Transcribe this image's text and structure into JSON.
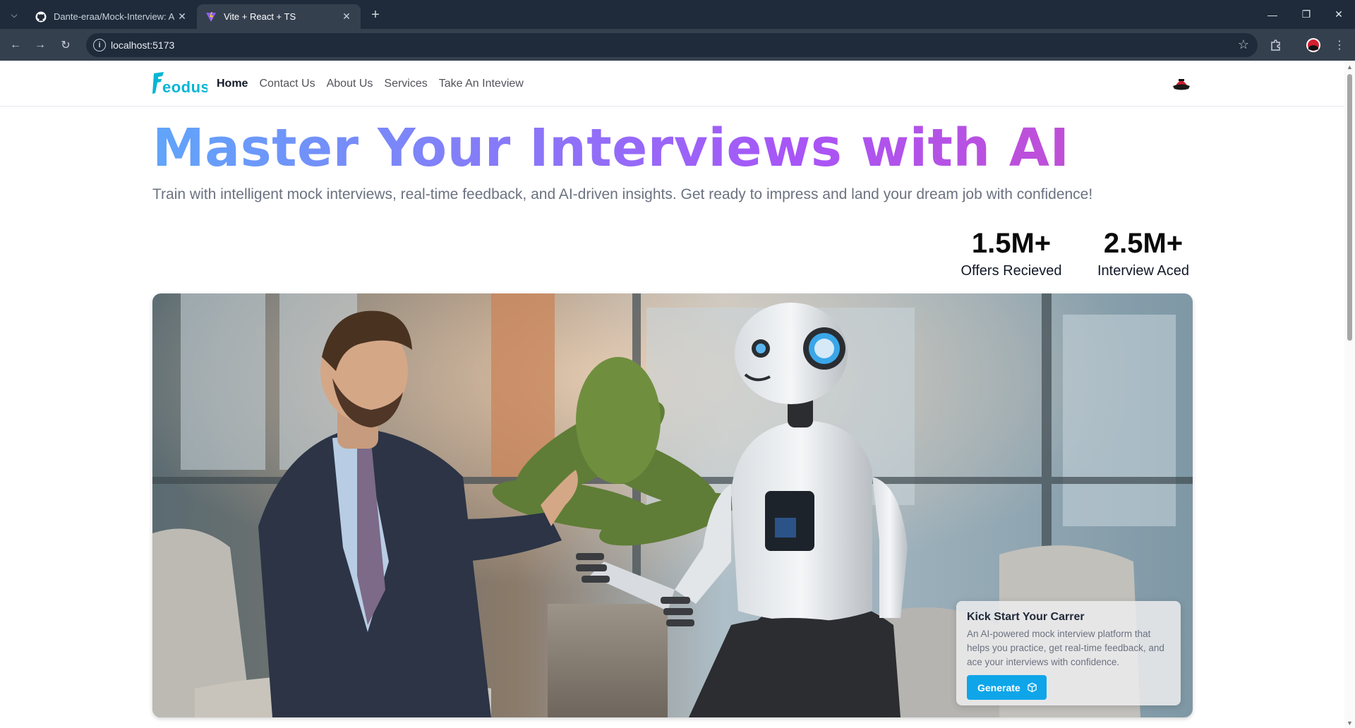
{
  "browser": {
    "tabs": [
      {
        "title": "Dante-eraa/Mock-Interview: A M",
        "icon": "github-icon",
        "active": false
      },
      {
        "title": "Vite + React + TS",
        "icon": "vite-icon",
        "active": true
      }
    ],
    "url": "localhost:5173"
  },
  "header": {
    "logo_text": "Feodus",
    "nav": [
      {
        "label": "Home",
        "active": true
      },
      {
        "label": "Contact Us",
        "active": false
      },
      {
        "label": "About Us",
        "active": false
      },
      {
        "label": "Services",
        "active": false
      },
      {
        "label": "Take An Inteview",
        "active": false
      }
    ]
  },
  "hero": {
    "title": "Master Your Interviews with AI",
    "subtitle": "Train with intelligent mock interviews, real-time feedback, and AI-driven insights. Get ready to impress and land your dream job with confidence!"
  },
  "stats": [
    {
      "value": "1.5M+",
      "label": "Offers Recieved"
    },
    {
      "value": "2.5M+",
      "label": "Interview Aced"
    }
  ],
  "promo": {
    "title": "Kick Start Your Carrer",
    "description": "An AI-powered mock interview platform that helps you practice, get real-time feedback, and ace your interviews with confidence.",
    "button_label": "Generate"
  },
  "colors": {
    "accent": "#0ea5e9",
    "gradient_start": "#60a5fa",
    "gradient_end": "#c04fd6"
  }
}
